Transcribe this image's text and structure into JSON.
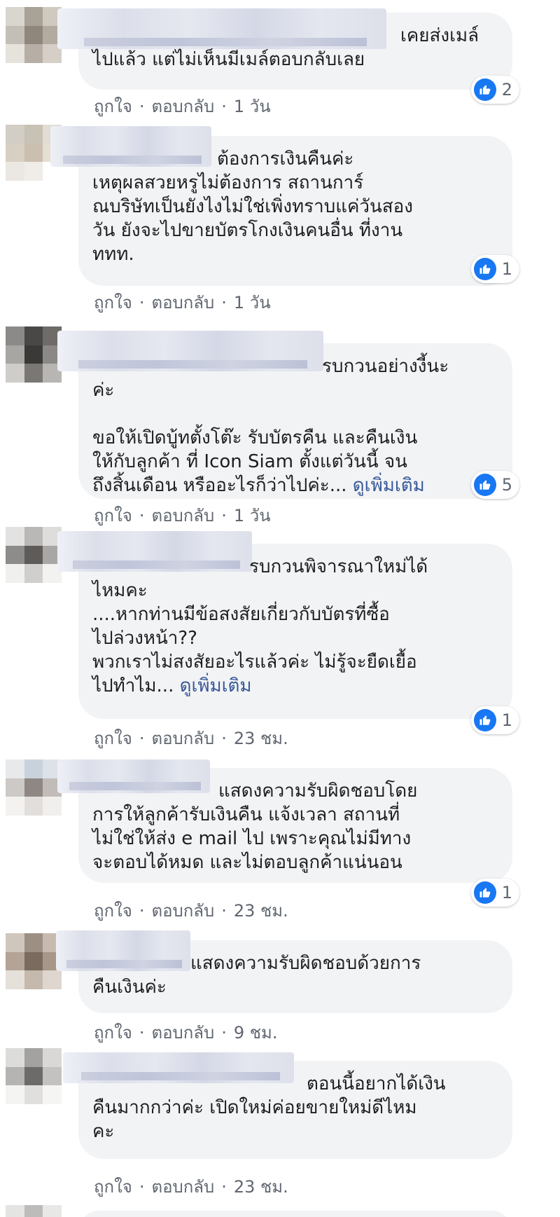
{
  "actions": {
    "like": "ถูกใจ",
    "reply": "ตอบกลับ",
    "separator": "·"
  },
  "comments": [
    {
      "first": "เคยส่งเมล์",
      "rest": "ไปแล้ว แต่ไม่เห็นมีเมล์ตอบกลับเลย",
      "see_more": "",
      "reactions": "2",
      "time": "1 วัน"
    },
    {
      "first": "ต้องการเงินคืนค่ะ",
      "rest": "เหตุผลสวยหรูไม่ต้องการ สถานการ์\nณบริษัทเป็นยังไงไม่ใช่เพิ่งทราบแค่วันสอง\nวัน ยังจะไปขายบัตรโกงเงินคนอื่น ที่งาน\nททท.",
      "see_more": "",
      "reactions": "1",
      "time": "1 วัน"
    },
    {
      "first": "รบกวนอย่างงี้นะ",
      "rest": "ค่ะ\n\nขอให้เปิดบู้ทตั้งโต๊ะ รับบัตรคืน และคืนเงิน\nให้กับลูกค้า ที่ Icon Siam ตั้งแต่วันนี้ จน\nถึงสิ้นเดือน หรืออะไรก็ว่าไปค่ะ...",
      "see_more": "ดูเพิ่มเติม",
      "reactions": "5",
      "time": "1 วัน"
    },
    {
      "first": "รบกวนพิจารณาใหม่ได้",
      "rest": "ไหมคะ\n....หากท่านมีข้อสงสัยเกี่ยวกับบัตรที่ซื้อ\nไปล่วงหน้า??\nพวกเราไม่สงสัยอะไรแล้วค่ะ ไม่รู้จะยืดเยื้อ\nไปทำไม...",
      "see_more": "ดูเพิ่มเติม",
      "reactions": "1",
      "time": "23 ชม."
    },
    {
      "first": "แสดงความรับผิดชอบโดย",
      "rest": "การให้ลูกค้ารับเงินคืน แจ้งเวลา สถานที่\nไม่ใช่ให้ส่ง e mail ไป เพราะคุณไม่มีทาง\nจะตอบได้หมด และไม่ตอบลูกค้าแน่นอน",
      "see_more": "",
      "reactions": "1",
      "time": "23 ชม."
    },
    {
      "first": "แสดงความรับผิดชอบด้วยการ",
      "rest": "คืนเงินค่ะ",
      "see_more": "",
      "reactions": "",
      "time": "9 ชม."
    },
    {
      "first": "ตอนนี้อยากได้เงิน",
      "rest": "คืนมากกว่าค่ะ เปิดใหม่ค่อยขายใหม่ดีไหม\nคะ",
      "see_more": "",
      "reactions": "",
      "time": "23 ชม."
    }
  ]
}
